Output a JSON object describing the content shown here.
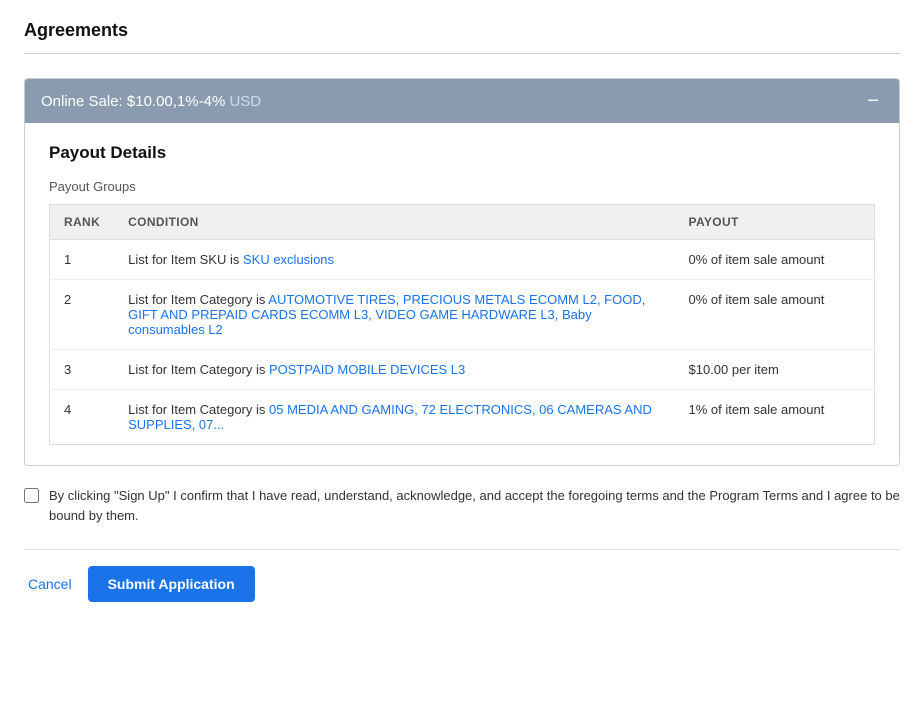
{
  "page": {
    "title": "Agreements"
  },
  "agreement": {
    "header": {
      "title": "Online Sale: $10.00,1%-4%",
      "currency": "USD",
      "collapse_icon": "−"
    },
    "payout_details": {
      "title": "Payout Details",
      "groups_label": "Payout Groups",
      "table": {
        "columns": [
          {
            "key": "rank",
            "label": "RANK"
          },
          {
            "key": "condition",
            "label": "CONDITION"
          },
          {
            "key": "payout",
            "label": "PAYOUT"
          }
        ],
        "rows": [
          {
            "rank": "1",
            "condition_prefix": "List for Item SKU is ",
            "condition_link": "SKU exclusions",
            "condition_suffix": "",
            "payout": "0% of item sale amount"
          },
          {
            "rank": "2",
            "condition_prefix": "List for Item Category is ",
            "condition_link": "AUTOMOTIVE TIRES, PRECIOUS METALS ECOMM L2, FOOD, GIFT AND PREPAID CARDS ECOMM L3, VIDEO GAME HARDWARE L3, Baby consumables L2",
            "condition_suffix": "",
            "payout": "0% of item sale amount"
          },
          {
            "rank": "3",
            "condition_prefix": "List for Item Category is ",
            "condition_link": "POSTPAID MOBILE DEVICES L3",
            "condition_suffix": "",
            "payout": "$10.00 per item"
          },
          {
            "rank": "4",
            "condition_prefix": "List for Item Category is ",
            "condition_link": "05 MEDIA AND GAMING, 72 ELECTRONICS, 06 CAMERAS AND SUPPLIES, 07",
            "condition_suffix": "",
            "payout": "1% of item sale amount"
          }
        ]
      }
    },
    "terms": {
      "text": "By clicking \"Sign Up\" I confirm that I have read, understand, acknowledge, and accept the foregoing terms and the Program Terms and I agree to be bound by them."
    }
  },
  "footer": {
    "cancel_label": "Cancel",
    "submit_label": "Submit Application"
  }
}
